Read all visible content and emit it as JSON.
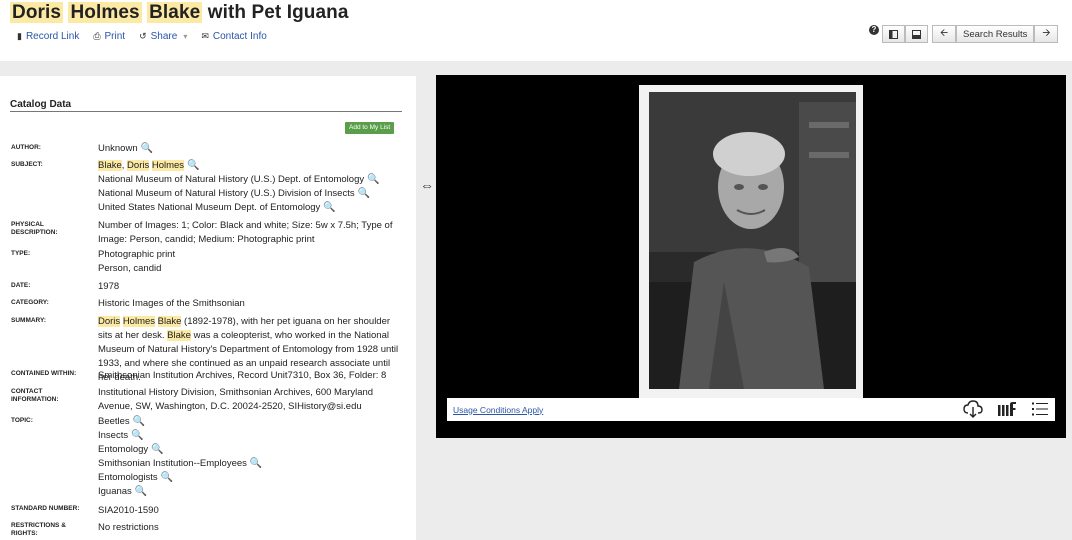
{
  "header": {
    "title_parts": [
      "Doris",
      "Holmes",
      "Blake",
      "with Pet Iguana"
    ],
    "actions": {
      "record_link": "Record Link",
      "print": "Print",
      "share": "Share",
      "contact_info": "Contact Info"
    },
    "help_glyph": "?",
    "search_results": "Search Results"
  },
  "catalog": {
    "heading": "Catalog Data",
    "add_button": "Add to My List",
    "labels": {
      "author": "Author:",
      "subject": "Subject:",
      "physical_1": "Physical",
      "physical_2": "Description:",
      "type": "Type:",
      "date": "Date:",
      "category": "Category:",
      "summary": "Summary:",
      "contained": "Contained within:",
      "contact_1": "Contact",
      "contact_2": "Information:",
      "topic": "Topic:",
      "standard": "Standard Number:",
      "restrictions_1": "Restrictions &",
      "restrictions_2": "Rights:"
    },
    "author": "Unknown",
    "subject": {
      "name_1": "Blake",
      "name_sep": ", ",
      "name_2": "Doris",
      "name_3": "Holmes",
      "lines": [
        "National Museum of Natural History (U.S.) Dept. of Entomology",
        "National Museum of Natural History (U.S.) Division of Insects",
        "United States National Museum Dept. of Entomology"
      ]
    },
    "physical_description": "Number of Images: 1; Color: Black and white; Size: 5w x 7.5h; Type of Image: Person, candid; Medium: Photographic print",
    "type": [
      "Photographic print",
      "Person, candid"
    ],
    "date": "1978",
    "category": "Historic Images of the Smithsonian",
    "summary": {
      "hl_1": "Doris",
      "hl_2": "Holmes",
      "hl_3": "Blake",
      "text_1": " (1892-1978), with her pet iguana on her shoulder sits at her desk. ",
      "hl_4": "Blake",
      "text_2": " was a coleopterist, who worked in the National Museum of Natural History's Department of Entomology from 1928 until 1933, and where she continued as an unpaid research associate until her death."
    },
    "contained_within": "Smithsonian Institution Archives, Record Unit7310, Box 36, Folder: 8",
    "contact_information": "Institutional History Division, Smithsonian Archives, 600 Maryland Avenue, SW, Washington, D.C. 20024-2520, SIHistory@si.edu",
    "topics": [
      "Beetles",
      "Insects",
      "Entomology",
      "Smithsonian Institution--Employees",
      "Entomologists",
      "Iguanas"
    ],
    "standard_number": "SIA2010-1590",
    "restrictions": "No restrictions"
  },
  "viewer": {
    "usage_link": "Usage Conditions Apply"
  },
  "icons": {
    "search": "magnifier-icon",
    "record_link": "document-icon",
    "print": "printer-icon",
    "share": "share-icon",
    "contact": "envelope-icon",
    "download": "cloud-download-icon",
    "iiif": "iiif-logo-icon",
    "list": "list-icon"
  },
  "colors": {
    "highlight": "#fbe9a4",
    "link": "#2a55a8",
    "add_button": "#5a9e4a"
  }
}
